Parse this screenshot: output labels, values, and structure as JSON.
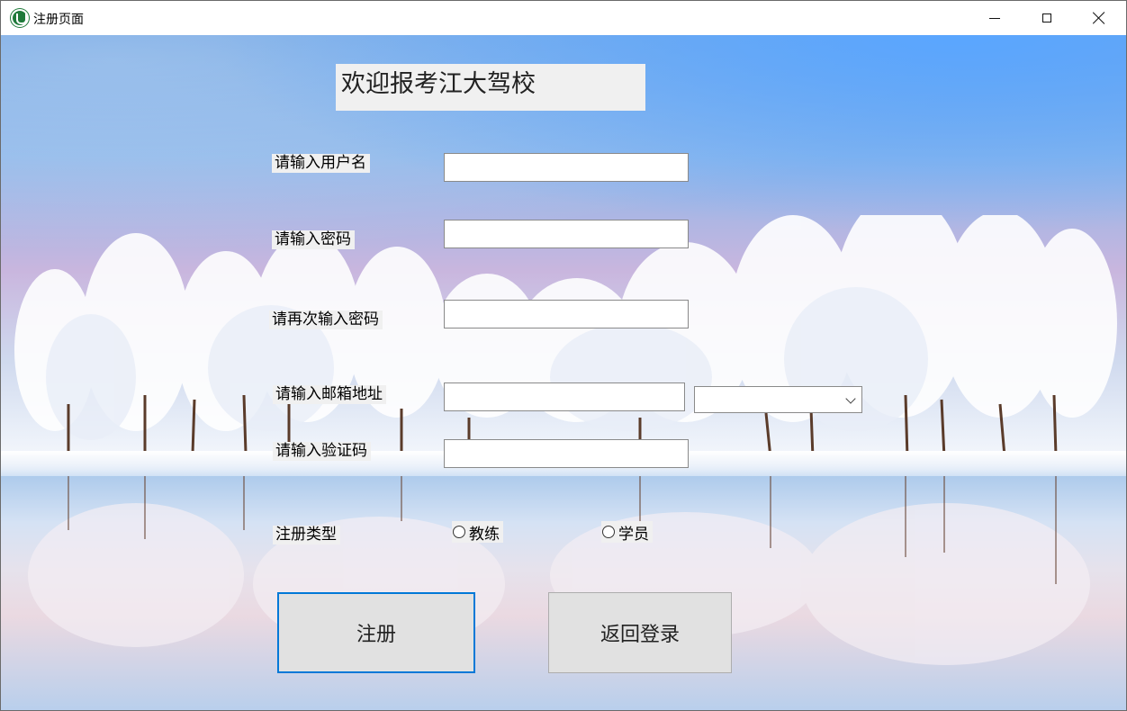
{
  "window": {
    "title": "注册页面"
  },
  "form": {
    "heading": "欢迎报考江大驾校",
    "username_label": "请输入用户名",
    "username_value": "",
    "password_label": "请输入密码",
    "password_value": "",
    "confirm_password_label": "请再次输入密码",
    "confirm_password_value": "",
    "email_label": "请输入邮箱地址",
    "email_value": "",
    "email_domain_selected": "",
    "code_label": "请输入验证码",
    "code_value": "",
    "type_label": "注册类型",
    "type_options": [
      "教练",
      "学员"
    ],
    "register_button": "注册",
    "back_button": "返回登录"
  },
  "colors": {
    "focus_border": "#0078d7",
    "control_bg": "#f0f0f0",
    "button_bg": "#e1e1e1"
  }
}
